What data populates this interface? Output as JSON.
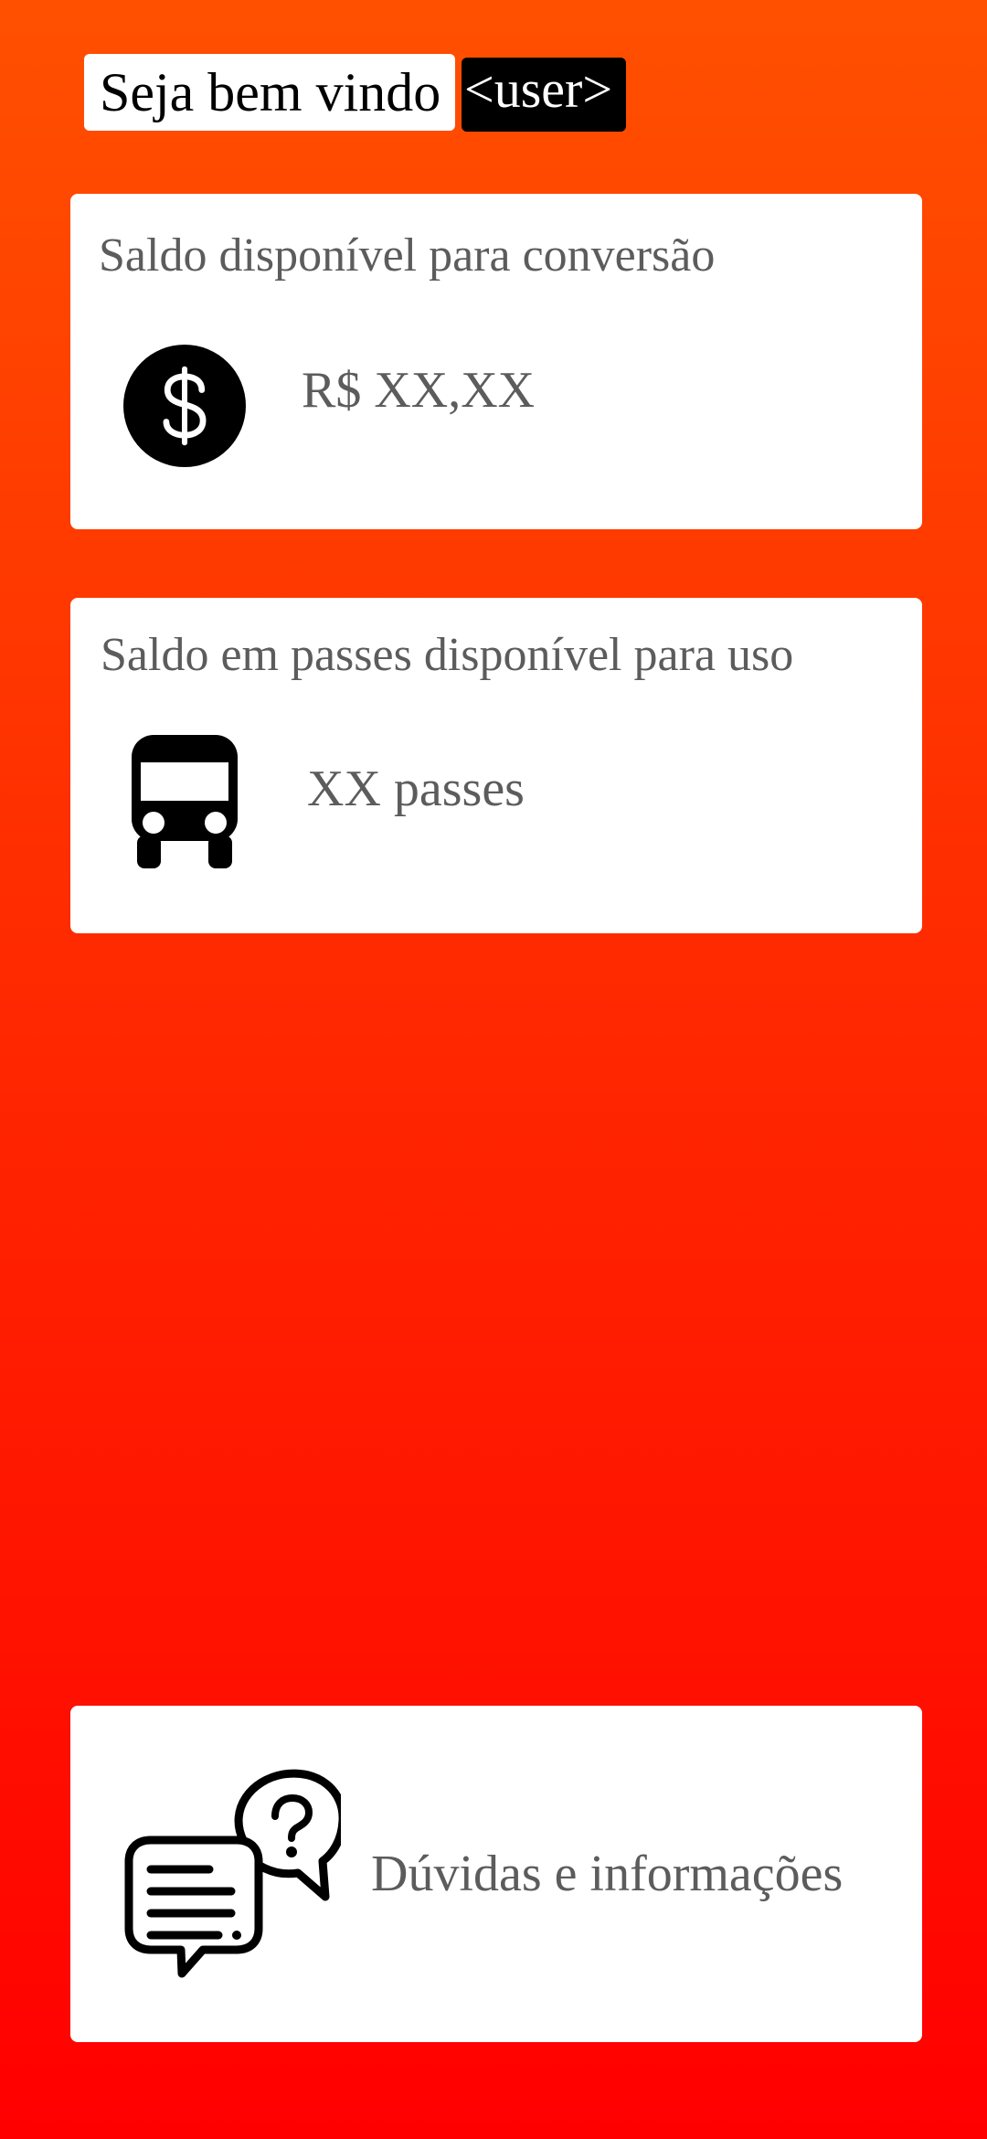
{
  "header": {
    "welcome_text": "Seja bem vindo",
    "user_placeholder": "<user>"
  },
  "conversion_card": {
    "title": "Saldo disponível para conversão",
    "value": "R$ XX,XX",
    "icon": "dollar-icon"
  },
  "passes_card": {
    "title": "Saldo em passes disponível para uso",
    "value": "XX passes",
    "icon": "bus-icon"
  },
  "help_card": {
    "label": "Dúvidas e informações",
    "icon": "chat-question-icon"
  },
  "colors": {
    "background_top": "#ff5000",
    "background_bottom": "#ff0000",
    "card_background": "#ffffff",
    "text_gray": "#5c5c5c",
    "user_badge": "#000000"
  }
}
